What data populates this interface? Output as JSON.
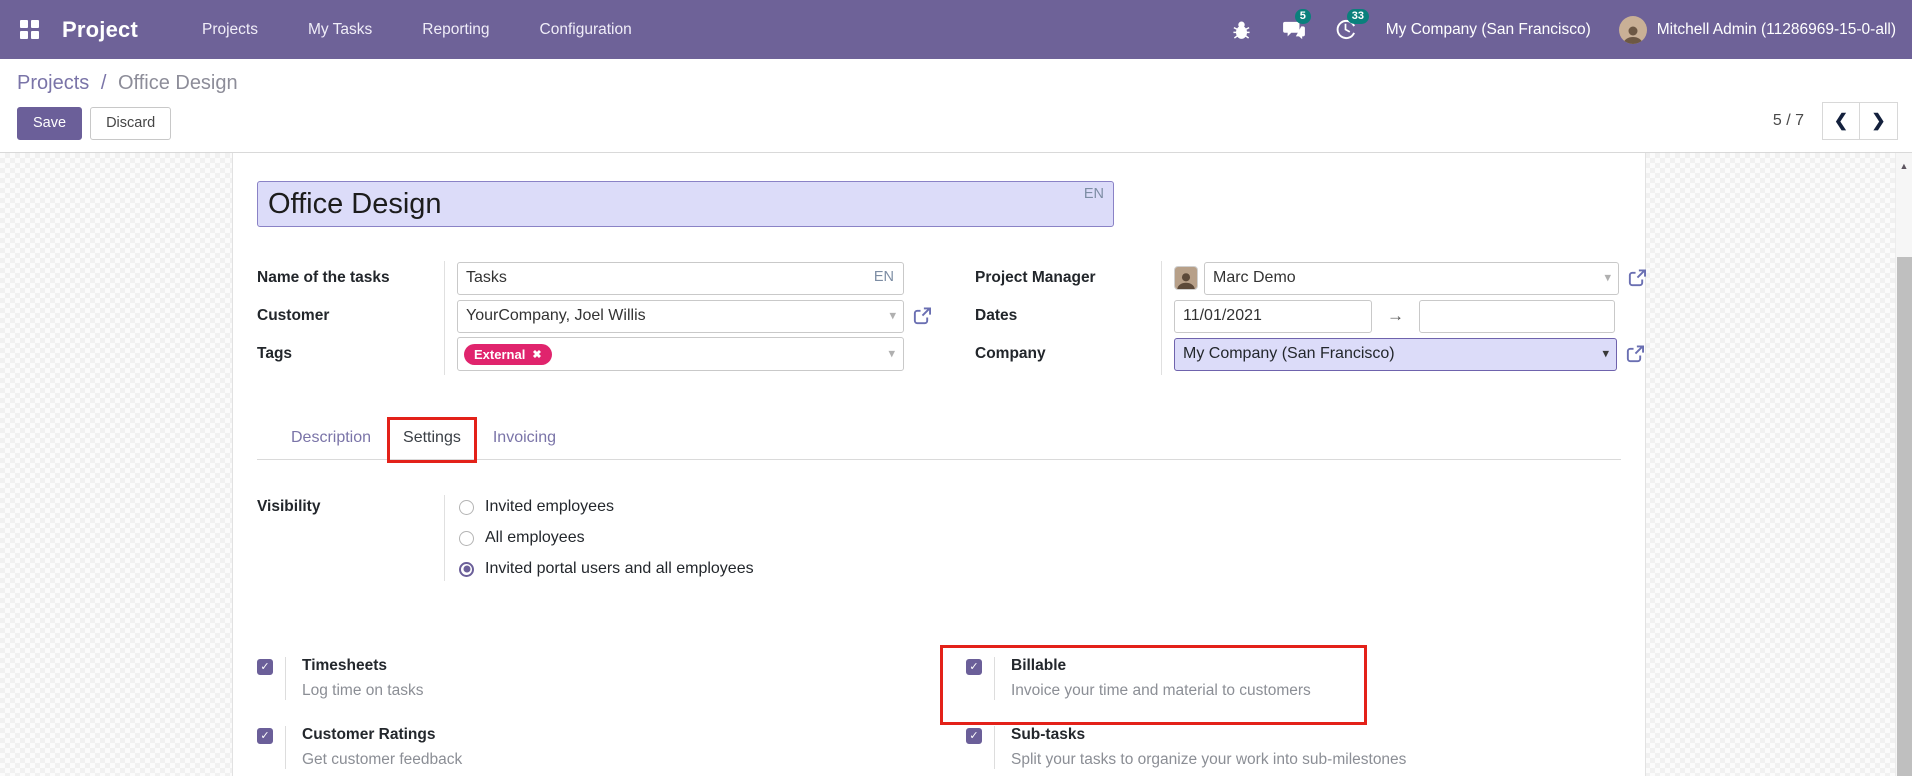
{
  "navbar": {
    "app": "Project",
    "menus": [
      "Projects",
      "My Tasks",
      "Reporting",
      "Configuration"
    ],
    "messages_count": "5",
    "activities_count": "33",
    "company": "My Company (San Francisco)",
    "user": "Mitchell Admin (11286969-15-0-all)"
  },
  "control_panel": {
    "breadcrumb": {
      "parent": "Projects",
      "separator": "/",
      "current": "Office Design"
    },
    "save": "Save",
    "discard": "Discard",
    "pager": "5 / 7"
  },
  "sheet": {
    "title": "Office Design",
    "title_lang": "EN",
    "fields": {
      "name_label": "Name of the tasks",
      "name_value": "Tasks",
      "name_lang": "EN",
      "customer_label": "Customer",
      "customer_value": "YourCompany, Joel Willis",
      "tags_label": "Tags",
      "tag_label": "External",
      "manager_label": "Project Manager",
      "manager_value": "Marc Demo",
      "dates_label": "Dates",
      "date_start": "11/01/2021",
      "company_label": "Company",
      "company_value": "My Company (San Francisco)"
    },
    "tabs": [
      {
        "label": "Description"
      },
      {
        "label": "Settings"
      },
      {
        "label": "Invoicing"
      }
    ],
    "visibility": {
      "label": "Visibility",
      "options": [
        {
          "label": "Invited employees",
          "selected": false
        },
        {
          "label": "All employees",
          "selected": false
        },
        {
          "label": "Invited portal users and all employees",
          "selected": true
        }
      ]
    },
    "settings": [
      {
        "title": "Timesheets",
        "desc": "Log time on tasks",
        "checked": true
      },
      {
        "title": "Billable",
        "desc": "Invoice your time and material to customers",
        "checked": true,
        "annotated": true
      },
      {
        "title": "Customer Ratings",
        "desc": "Get customer feedback",
        "checked": true
      },
      {
        "title": "Sub-tasks",
        "desc": "Split your tasks to organize your work into sub-milestones",
        "checked": true
      }
    ]
  },
  "colors": {
    "navbar_bg": "#6e6298",
    "accent_purple": "#6b5f99",
    "badge_teal": "#0a807c",
    "tag_pink": "#e0246d",
    "annotation_red": "#e32119",
    "highlight_lavender": "#dcdcf9",
    "link_purple": "#7a74a8"
  },
  "icons": {
    "caret": "▾",
    "close": "✖",
    "check": "✓",
    "arrow_right": "→",
    "chevron_left": "❮",
    "chevron_right": "❯",
    "scroll_up": "▲"
  }
}
